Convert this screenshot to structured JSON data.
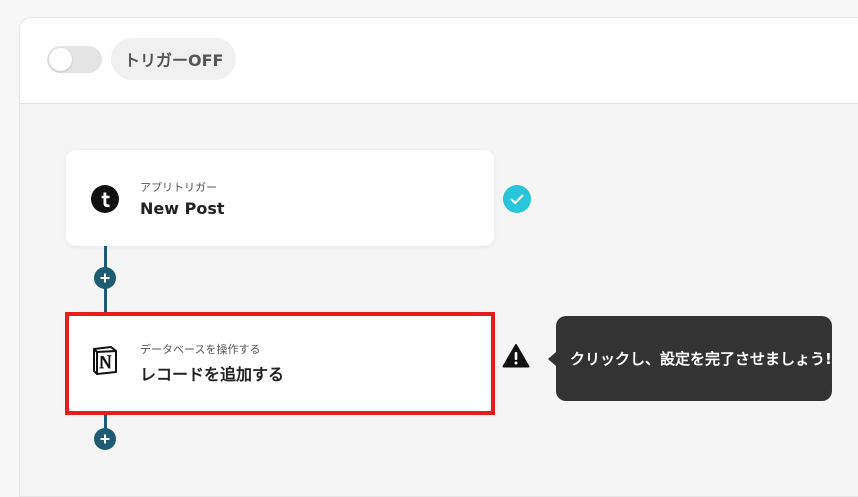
{
  "header": {
    "trigger_status": "トリガーOFF",
    "trigger_enabled": false
  },
  "flow": {
    "steps": [
      {
        "app": "Tumblr",
        "icon": "tumblr-icon",
        "subtitle": "アプリトリガー",
        "title": "New Post",
        "status": "completed"
      },
      {
        "app": "Notion",
        "icon": "notion-icon",
        "subtitle": "データベースを操作する",
        "title": "レコードを追加する",
        "status": "incomplete"
      }
    ]
  },
  "tooltip": {
    "text": "クリックし、設定を完了させましょう!"
  },
  "colors": {
    "connector": "#1f5c73",
    "check": "#28c6d8",
    "highlight": "#e41d1d",
    "tooltip_bg": "#333333"
  }
}
